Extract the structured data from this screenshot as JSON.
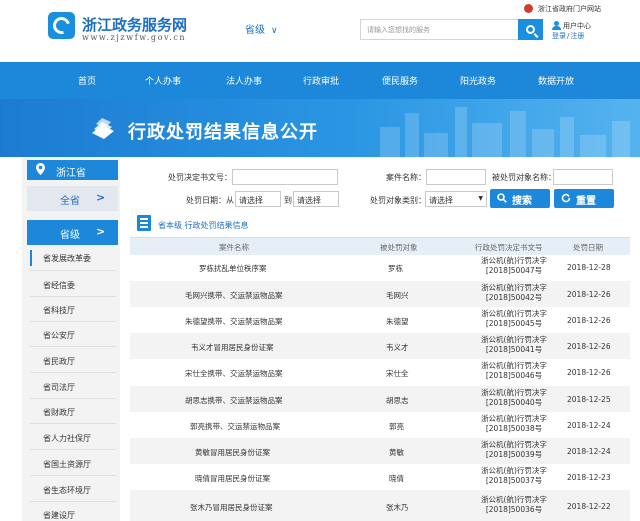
{
  "header": {
    "site_name": "浙江政务服务网",
    "site_url": "www.zjzwfw.gov.cn",
    "province_select": "省级",
    "search_placeholder": "请输入您想找的服务",
    "gov_portal": "浙江省政府门户网站",
    "user_center": "用户中心",
    "login": "登录",
    "register": "注册",
    "login_sep": "/"
  },
  "nav": {
    "items": [
      "首页",
      "个人办事",
      "法人办事",
      "行政审批",
      "便民服务",
      "阳光政务",
      "数据开放"
    ]
  },
  "banner": {
    "title": "行政处罚结果信息公开"
  },
  "sidebar": {
    "region": "浙江省",
    "all_label": "全省",
    "prov_level_label": "省级",
    "departments": [
      "省发展改革委",
      "省经信委",
      "省科技厅",
      "省公安厅",
      "省民政厅",
      "省司法厅",
      "省财政厅",
      "省人力社保厅",
      "省国土资源厅",
      "省生态环境厅",
      "省建设厅"
    ]
  },
  "filters": {
    "decision_no_label": "处罚决定书文号：",
    "case_name_label": "案件名称：",
    "target_name_label": "被处罚对象名称：",
    "date_label": "处罚日期：从",
    "date_from": "请选择",
    "date_to_label": "到",
    "date_to": "请选择",
    "target_type_label": "处罚对象类别：",
    "target_type_value": "请选择",
    "search_button": "搜索",
    "reset_button": "重置"
  },
  "section": {
    "title": "省本级 行政处罚结果信息"
  },
  "table": {
    "headers": [
      "案件名称",
      "被处罚对象",
      "行政处罚决定书文号",
      "处罚日期"
    ],
    "rows": [
      {
        "case": "罗栋扰乱单位秩序案",
        "target": "罗栋",
        "doc1": "浙公机(航)行罚决字",
        "doc2": "[2018]50047号",
        "date": "2018-12-28"
      },
      {
        "case": "毛网兴携带、交运禁运物品案",
        "target": "毛网兴",
        "doc1": "浙公机(航)行罚决字",
        "doc2": "[2018]50042号",
        "date": "2018-12-26"
      },
      {
        "case": "朱德望携带、交运禁运物品案",
        "target": "朱德望",
        "doc1": "浙公机(航)行罚决字",
        "doc2": "[2018]50045号",
        "date": "2018-12-26"
      },
      {
        "case": "韦义才冒用居民身份证案",
        "target": "韦义才",
        "doc1": "浙公机(航)行罚决字",
        "doc2": "[2018]50041号",
        "date": "2018-12-26"
      },
      {
        "case": "宋仕全携带、交运禁运物品案",
        "target": "宋仕全",
        "doc1": "浙公机(航)行罚决字",
        "doc2": "[2018]50046号",
        "date": "2018-12-26"
      },
      {
        "case": "胡思志携带、交运禁运物品案",
        "target": "胡思志",
        "doc1": "浙公机(航)行罚决字",
        "doc2": "[2018]50040号",
        "date": "2018-12-25"
      },
      {
        "case": "郭亮携带、交运禁运物品案",
        "target": "郭亮",
        "doc1": "浙公机(航)行罚决字",
        "doc2": "[2018]50038号",
        "date": "2018-12-24"
      },
      {
        "case": "黄敏冒用居民身份证案",
        "target": "黄敏",
        "doc1": "浙公机(航)行罚决字",
        "doc2": "[2018]50039号",
        "date": "2018-12-24"
      },
      {
        "case": "晓倩冒用居民身份证案",
        "target": "晓倩",
        "doc1": "浙公机(航)行罚决字",
        "doc2": "[2018]50037号",
        "date": "2018-12-23"
      },
      {
        "case": "张木乃冒用居民身份证案",
        "target": "张木乃",
        "doc1": "浙公机(航)行罚决字",
        "doc2": "[2018]50036号",
        "date": "2018-12-22"
      }
    ]
  }
}
